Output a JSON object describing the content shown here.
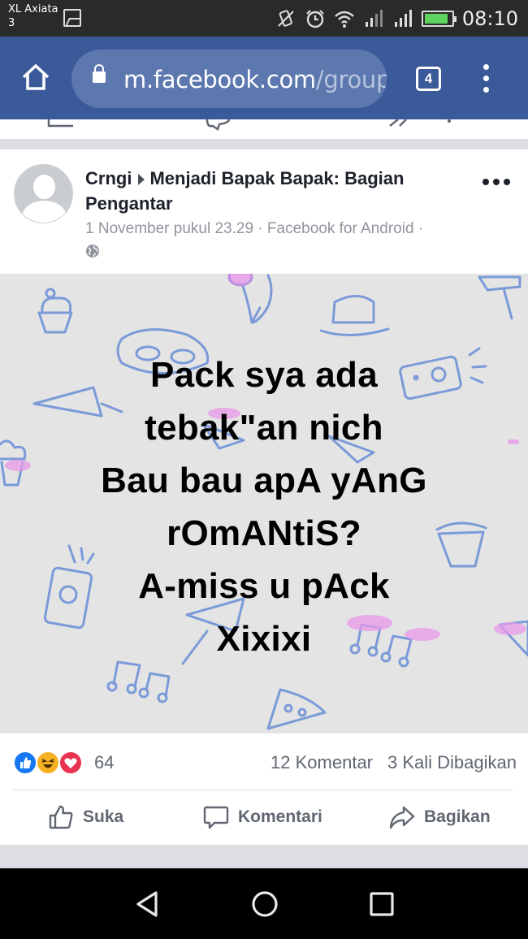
{
  "status_bar": {
    "carrier": "XL Axiata",
    "carrier_sub": "3",
    "time": "08:10"
  },
  "browser": {
    "url_host": "m.facebook.com",
    "url_path": "/groups",
    "tab_count": "4"
  },
  "post": {
    "author": "Crngi",
    "group": "Menjadi Bapak Bapak: Bagian Pengantar",
    "meta": "1 November pukul 23.29 · Facebook for Android ·",
    "image_text": [
      "Pack sya ada",
      "tebak\"an nich",
      "Bau bau apA yAnG",
      "rOmANtiS?",
      "A-miss u pAck",
      "Xixixi"
    ],
    "reactions": {
      "icons": [
        "like-reaction-icon",
        "haha-reaction-icon",
        "love-reaction-icon"
      ],
      "colors": {
        "like": "#1877f2",
        "haha": "#f7b125",
        "love": "#e8324f"
      },
      "count": "64"
    },
    "comments": "12 Komentar",
    "shares": "3 Kali Dibagikan",
    "actions": {
      "like": "Suka",
      "comment": "Komentari",
      "share": "Bagikan"
    }
  },
  "theme": {
    "browser_bar": "#3b5a9a",
    "url_pill": "#5d78ae"
  }
}
